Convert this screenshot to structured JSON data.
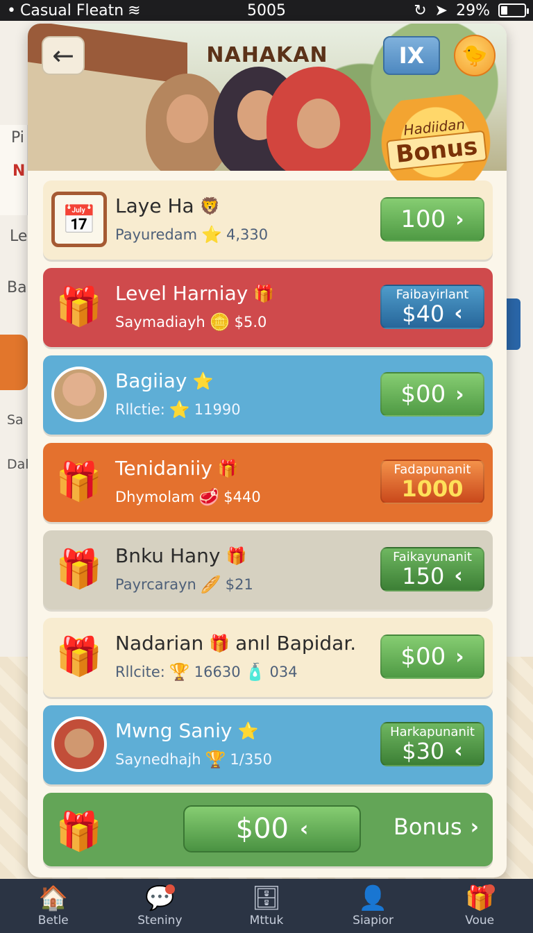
{
  "status_bar": {
    "carrier": "Casual Fleatn",
    "time": "5005",
    "battery": "29%",
    "battery_level": 0.29
  },
  "modal": {
    "title": "NAHAKAN",
    "close_label": "IX",
    "badge": {
      "top": "Hadiidan",
      "main": "Bonus"
    }
  },
  "rows": [
    {
      "title": "Laye Ha",
      "title_icon": "🦁",
      "sub_label": "Payuredam",
      "sub_icon": "⭐",
      "sub_value": "4,330",
      "btn_caption": "",
      "btn_value": "100",
      "btn_dir": "›",
      "color": "cream",
      "thumb": "calendar-icon"
    },
    {
      "title": "Level Harniay",
      "title_icon": "🎁",
      "sub_label": "Saymadiayh",
      "sub_icon": "🪙",
      "sub_value": "$5.0",
      "btn_caption": "Faibayirlant",
      "btn_value": "$40",
      "btn_dir": "‹",
      "color": "red",
      "thumb": "gift-icon"
    },
    {
      "title": "Bagiiay",
      "title_icon": "⭐",
      "sub_label": "Rllctie:",
      "sub_icon": "⭐",
      "sub_value": "11990",
      "btn_caption": "",
      "btn_value": "$00",
      "btn_dir": "›",
      "color": "blue",
      "thumb": "portrait-icon"
    },
    {
      "title": "Tenidaniiy",
      "title_icon": "🎁",
      "sub_label": "Dhymolam",
      "sub_icon": "🥩",
      "sub_value": "$440",
      "btn_caption": "Fadapunanit",
      "btn_value": "1000",
      "btn_dir": "",
      "color": "orange",
      "thumb": "gift-icon"
    },
    {
      "title": "Bnku Hany",
      "title_icon": "🎁",
      "sub_label": "Payrcarayn",
      "sub_icon": "🥖",
      "sub_value": "$21",
      "btn_caption": "Faikayunanit",
      "btn_value": "150",
      "btn_dir": "‹",
      "color": "grey",
      "thumb": "gift-icon"
    },
    {
      "title": "Nadarian",
      "title_icon": "🎁",
      "title_tail": "anıl Bapidar.",
      "sub_label": "Rllcite:",
      "sub_icon": "🏆",
      "sub_value": "16630",
      "sub_icon2": "🧴",
      "sub_value2": "034",
      "btn_caption": "",
      "btn_value": "$00",
      "btn_dir": "›",
      "color": "cream",
      "thumb": "gift-icon"
    },
    {
      "title": "Mwng Saniy",
      "title_icon": "⭐",
      "sub_label": "Saynedhajh",
      "sub_icon": "🏆",
      "sub_value": "1/350",
      "btn_caption": "Harkapunanit",
      "btn_value": "$30",
      "btn_dir": "‹",
      "color": "blue",
      "thumb": "portrait-icon"
    }
  ],
  "footer_row": {
    "btn_value": "$00",
    "btn_dir": "‹",
    "link_label": "Bonus",
    "link_dir": "›"
  },
  "nav": [
    {
      "label": "Betle",
      "icon": "home-icon",
      "badge": false
    },
    {
      "label": "Steniny",
      "icon": "chat-icon",
      "badge": true
    },
    {
      "label": "Mttuk",
      "icon": "stack-icon",
      "badge": false
    },
    {
      "label": "Siapior",
      "icon": "person-icon",
      "badge": false
    },
    {
      "label": "Voue",
      "icon": "gift-icon",
      "badge": true
    }
  ],
  "background": {
    "items": [
      "Pi",
      "N",
      "Lei",
      "Ba",
      "Sa",
      "Dal"
    ]
  }
}
